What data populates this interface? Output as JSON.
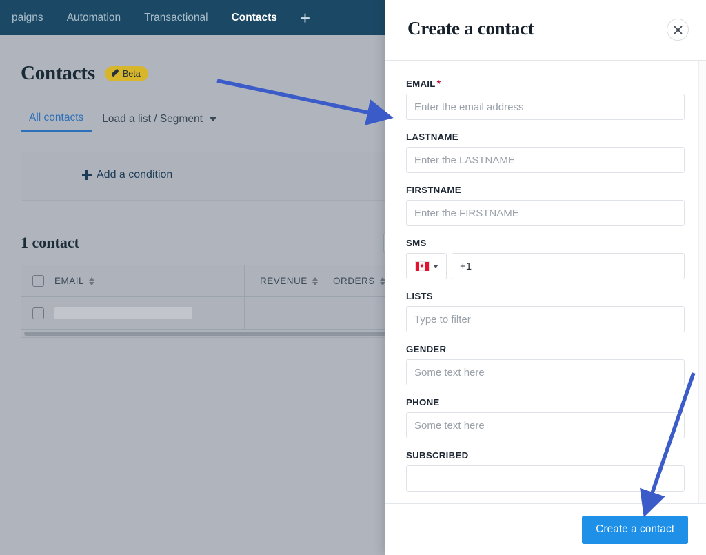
{
  "topnav": {
    "items": [
      {
        "label": "paigns",
        "active": false
      },
      {
        "label": "Automation",
        "active": false
      },
      {
        "label": "Transactional",
        "active": false
      },
      {
        "label": "Contacts",
        "active": true
      }
    ],
    "add_icon": "+"
  },
  "page": {
    "title": "Contacts",
    "beta_badge": "Beta",
    "tabs": [
      {
        "label": "All contacts",
        "active": true
      },
      {
        "label": "Load a list / Segment",
        "active": false
      }
    ],
    "add_condition": "Add a condition",
    "count_label": "1  contact"
  },
  "table": {
    "columns": [
      "EMAIL",
      "REVENUE",
      "ORDERS"
    ],
    "rows": [
      {
        "email": "",
        "revenue": "",
        "orders": ""
      }
    ]
  },
  "panel": {
    "title": "Create a contact",
    "close_icon": "close-icon",
    "fields": [
      {
        "label": "EMAIL",
        "required": true,
        "placeholder": "Enter the email address",
        "value": ""
      },
      {
        "label": "LASTNAME",
        "required": false,
        "placeholder": "Enter the LASTNAME",
        "value": ""
      },
      {
        "label": "FIRSTNAME",
        "required": false,
        "placeholder": "Enter the FIRSTNAME",
        "value": ""
      },
      {
        "label": "SMS",
        "required": false,
        "placeholder": "",
        "value": "+1",
        "country": "CA"
      },
      {
        "label": "LISTS",
        "required": false,
        "placeholder": "Type to filter",
        "value": ""
      },
      {
        "label": "GENDER",
        "required": false,
        "placeholder": "Some text here",
        "value": ""
      },
      {
        "label": "PHONE",
        "required": false,
        "placeholder": "Some text here",
        "value": ""
      },
      {
        "label": "SUBSCRIBED",
        "required": false,
        "placeholder": "",
        "value": ""
      }
    ],
    "submit_label": "Create a contact"
  },
  "colors": {
    "navbar": "#1b4965",
    "accent_blue": "#1e90e8",
    "tab_active": "#2d6fb8",
    "beta_yellow": "#d8b62c",
    "required_star": "#b8123d",
    "arrow_blue": "#3b5bc8",
    "backdrop": "#b0b5bd"
  }
}
